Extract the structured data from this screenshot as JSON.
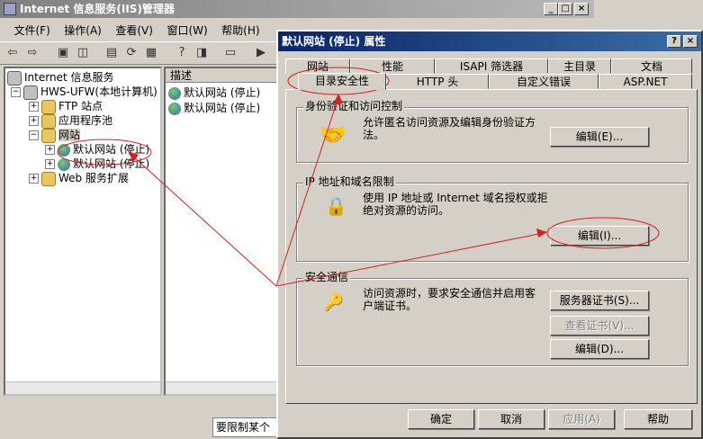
{
  "iis": {
    "title": "Internet 信息服务(IIS)管理器",
    "menu": [
      "文件(F)",
      "操作(A)",
      "查看(V)",
      "窗口(W)",
      "帮助(H)"
    ],
    "window_controls": [
      "_",
      "□",
      "×"
    ],
    "tree": {
      "root": "Internet 信息服务",
      "computer": "HWS-UFW(本地计算机)",
      "ftp": "FTP 站点",
      "apppool": "应用程序池",
      "websites": "网站",
      "site1": "默认网站 (停止)",
      "site2": "默认网站 (停止)",
      "webext": "Web 服务扩展"
    },
    "list_header": "描述",
    "list_items": [
      "默认网站 (停止)",
      "默认网站 (停止)"
    ],
    "status_text": "要限制某个"
  },
  "dialog": {
    "title": "默认网站 (停止) 属性",
    "help": "?",
    "close": "×",
    "tabs_row1": [
      "网站",
      "性能",
      "ISAPI 筛选器",
      "主目录",
      "文档"
    ],
    "tabs_row2": [
      "目录安全性",
      "HTTP 头",
      "自定义错误",
      "ASP.NET"
    ],
    "auth": {
      "label": "身份验证和访问控制",
      "text": "允许匿名访问资源及编辑身份验证方法。",
      "edit": "编辑(E)..."
    },
    "ip": {
      "label": "IP 地址和域名限制",
      "text": "使用 IP 地址或 Internet 域名授权或拒绝对资源的访问。",
      "edit": "编辑(I)..."
    },
    "secure": {
      "label": "安全通信",
      "text": "访问资源时，要求安全通信并启用客户端证书。",
      "server_cert": "服务器证书(S)...",
      "view_cert": "查看证书(V)...",
      "edit": "编辑(D)..."
    },
    "buttons": {
      "ok": "确定",
      "cancel": "取消",
      "apply": "应用(A)",
      "help": "帮助"
    }
  },
  "colors": {
    "annotation": "#d42020",
    "title_active": "#0a246a",
    "title_inactive": "#808080"
  }
}
